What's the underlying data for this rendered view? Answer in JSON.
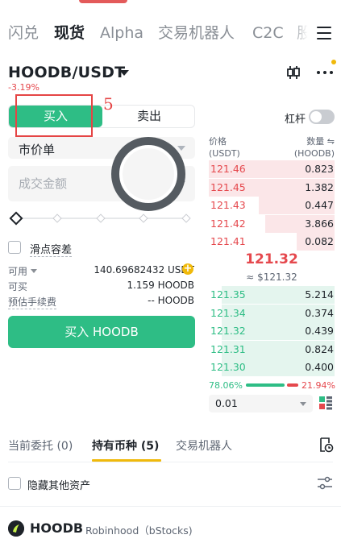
{
  "nav": {
    "tabs": [
      "闪兑",
      "现货",
      "Alpha",
      "交易机器人",
      "C2C",
      "股"
    ],
    "active_index": 1
  },
  "pair": {
    "symbol": "HOODB/USDT",
    "change": "-3.19%"
  },
  "trade_side": {
    "buy": "买入",
    "sell": "卖出",
    "active": "buy"
  },
  "annotation": {
    "label": "5"
  },
  "leverage": {
    "label": "杠杆",
    "enabled": false
  },
  "order_form": {
    "order_type": "市价单",
    "amount_placeholder": "成交金额",
    "slider_percent": 0,
    "slippage_label": "滑点容差",
    "available_label": "可用",
    "available_value": "140.69682432 USDT",
    "can_buy_label": "可买",
    "can_buy_value": "1.159 HOODB",
    "fee_label": "预估手续费",
    "fee_value": "-- HOODB",
    "submit_label": "买入 HOODB"
  },
  "order_book": {
    "price_header": "价格",
    "price_unit": "(USDT)",
    "qty_header": "数量 ⇋",
    "qty_unit": "(HOODB)",
    "asks": [
      {
        "price": "121.46",
        "qty": "0.823",
        "depth": 1.0
      },
      {
        "price": "121.45",
        "qty": "1.382",
        "depth": 1.0
      },
      {
        "price": "121.43",
        "qty": "0.447",
        "depth": 0.6
      },
      {
        "price": "121.42",
        "qty": "3.866",
        "depth": 0.55
      },
      {
        "price": "121.41",
        "qty": "0.082",
        "depth": 0.3
      }
    ],
    "last_price": "121.32",
    "last_price_usd": "≈ $121.32",
    "bids": [
      {
        "price": "121.35",
        "qty": "5.214",
        "depth": 0.9
      },
      {
        "price": "121.34",
        "qty": "0.374",
        "depth": 0.9
      },
      {
        "price": "121.32",
        "qty": "0.439",
        "depth": 0.9
      },
      {
        "price": "121.31",
        "qty": "0.824",
        "depth": 0.9
      },
      {
        "price": "121.30",
        "qty": "0.400",
        "depth": 0.9
      }
    ],
    "buy_ratio": "78.06%",
    "sell_ratio": "21.94%",
    "precision": "0.01"
  },
  "bottom_tabs": {
    "tabs": [
      "当前委托 (0)",
      "持有币种 (5)",
      "交易机器人"
    ],
    "active_index": 1
  },
  "holdings": {
    "hide_label": "隐藏其他资产",
    "asset_symbol": "HOODB",
    "asset_name": "Robinhood（bStocks)"
  },
  "colors": {
    "buy": "#2ebd85",
    "sell": "#e5484d",
    "accent": "#f0b90b"
  }
}
